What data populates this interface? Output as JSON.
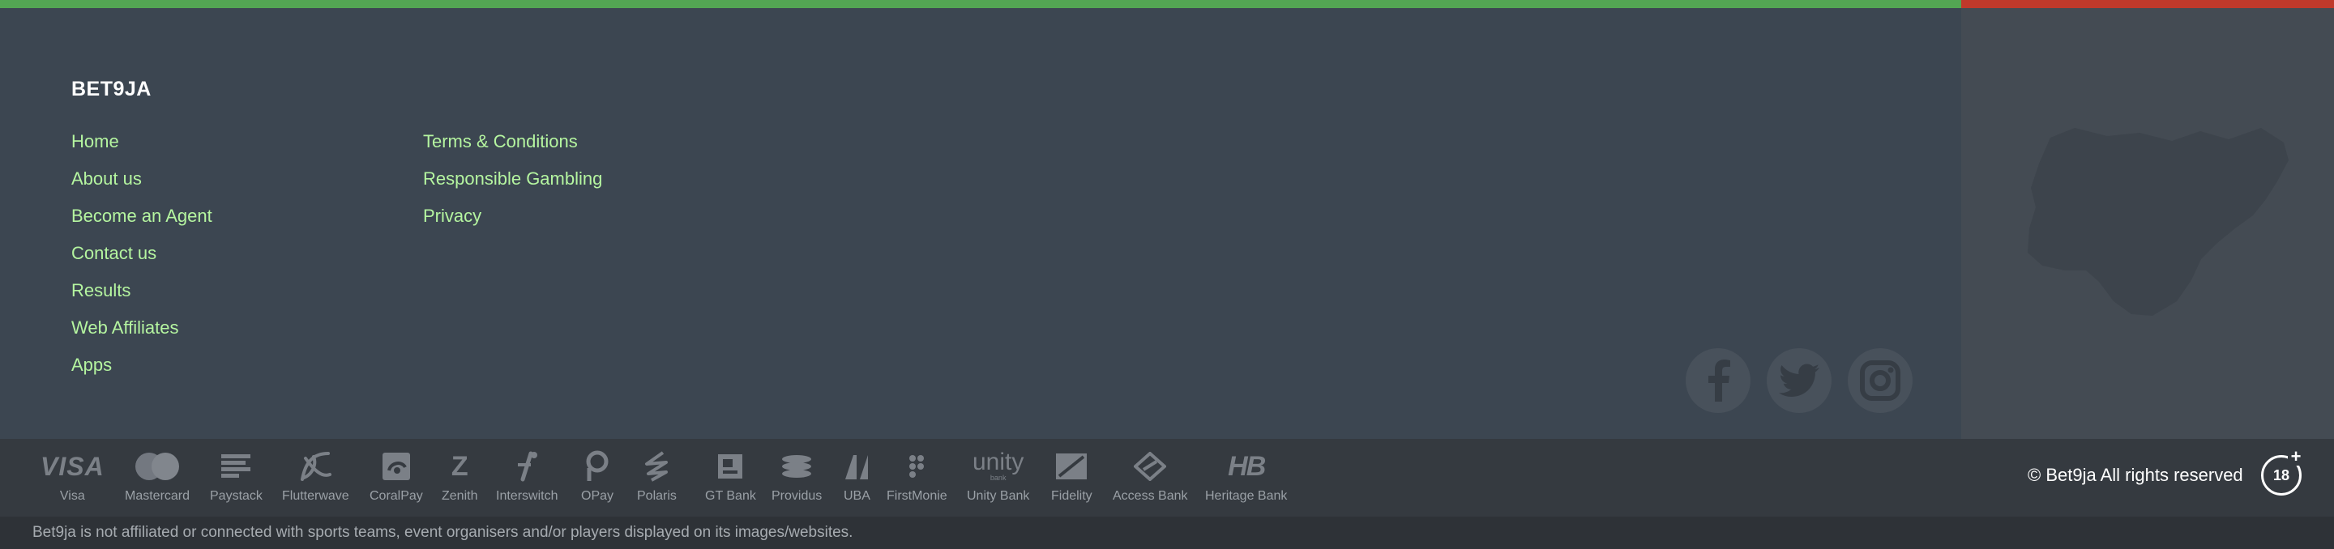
{
  "footer": {
    "brand": "BET9JA",
    "links_col1": [
      "Home",
      "About us",
      "Become an Agent",
      "Contact us",
      "Results",
      "Web Affiliates",
      "Apps"
    ],
    "links_col2": [
      "Terms & Conditions",
      "Responsible Gambling",
      "Privacy"
    ],
    "social": [
      "facebook-icon",
      "twitter-icon",
      "instagram-icon"
    ],
    "colors": {
      "accent_green": "#53a653",
      "accent_red": "#c0392b",
      "link": "#b5f5a0",
      "background": "#3c4651"
    }
  },
  "payments": {
    "providers": [
      "Visa",
      "Mastercard",
      "Paystack",
      "Flutterwave",
      "CoralPay",
      "Zenith",
      "Interswitch",
      "OPay",
      "Polaris",
      "GT Bank",
      "Providus",
      "UBA",
      "FirstMonie",
      "Unity Bank",
      "Fidelity",
      "Access Bank",
      "Heritage Bank"
    ],
    "visa_logo_text": "VISA",
    "zenith_logo_text": "Z",
    "unity_logo_text": "unity",
    "unity_logo_sub": "bank",
    "heritage_logo_text": "HB"
  },
  "copyright": "© Bet9ja All rights reserved",
  "age_badge": "18",
  "age_badge_plus": "+",
  "disclaimer": "Bet9ja is not affiliated or connected with sports teams, event organisers and/or players displayed on its images/websites."
}
